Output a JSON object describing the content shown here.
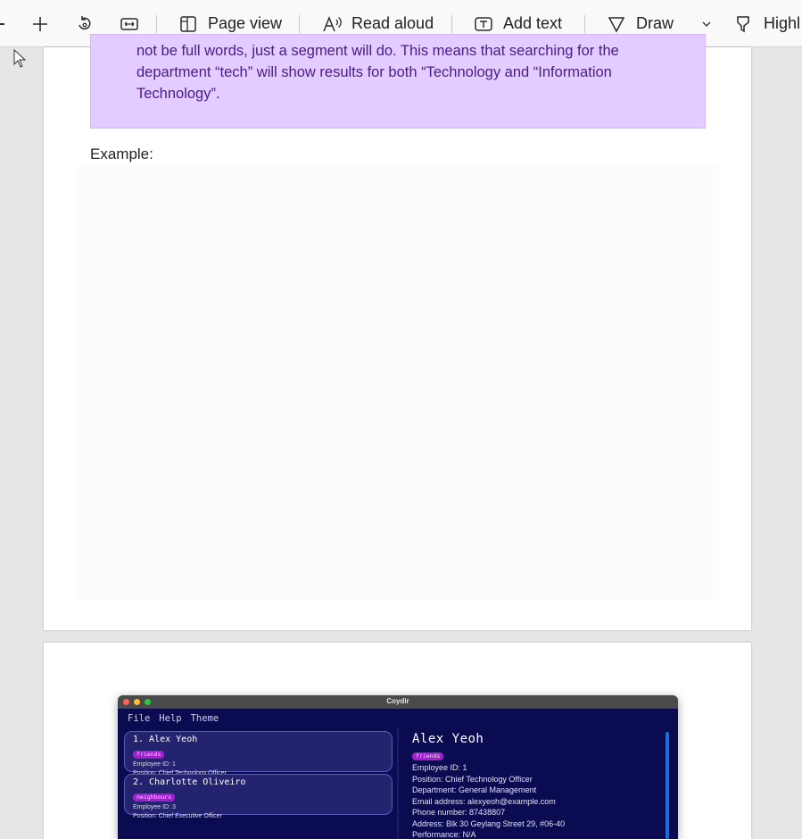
{
  "toolbar": {
    "page_view": "Page view",
    "read_aloud": "Read aloud",
    "add_text": "Add text",
    "draw": "Draw",
    "highlight": "Highl"
  },
  "doc": {
    "callout_lines": [
      "not be full words, just a segment will do. This means that searching for the",
      "department “tech” will show results for both “Technology and “Information",
      "Technology”."
    ],
    "example_label": "Example:"
  },
  "app": {
    "title": "Coydir",
    "menu": [
      "File",
      "Help",
      "Theme"
    ],
    "list": [
      {
        "name": "1. Alex Yeoh",
        "tag": "friends",
        "id": "Employee ID: 1",
        "position": "Position: Chief Technology Officer"
      },
      {
        "name": "2. Charlotte Oliveiro",
        "tag": "neighbours",
        "id": "Employee ID: 3",
        "position": "Position: Chief Executive Officer"
      }
    ],
    "detail": {
      "name": "Alex Yeoh",
      "tag": "friends",
      "lines": [
        "Employee ID: 1",
        "Position: Chief Technology Officer",
        "Department: General Management",
        "Email address: alexyeoh@example.com",
        "Phone number: 87438807",
        "Address: Blk 30 Geylang Street 29, #06-40",
        "Performance: N/A"
      ]
    }
  },
  "colors": {
    "callout_bg": "#e3ccff",
    "callout_text": "#4a1a8c",
    "app_bg": "#0b0b52",
    "tag_bg": "#a020d0"
  }
}
